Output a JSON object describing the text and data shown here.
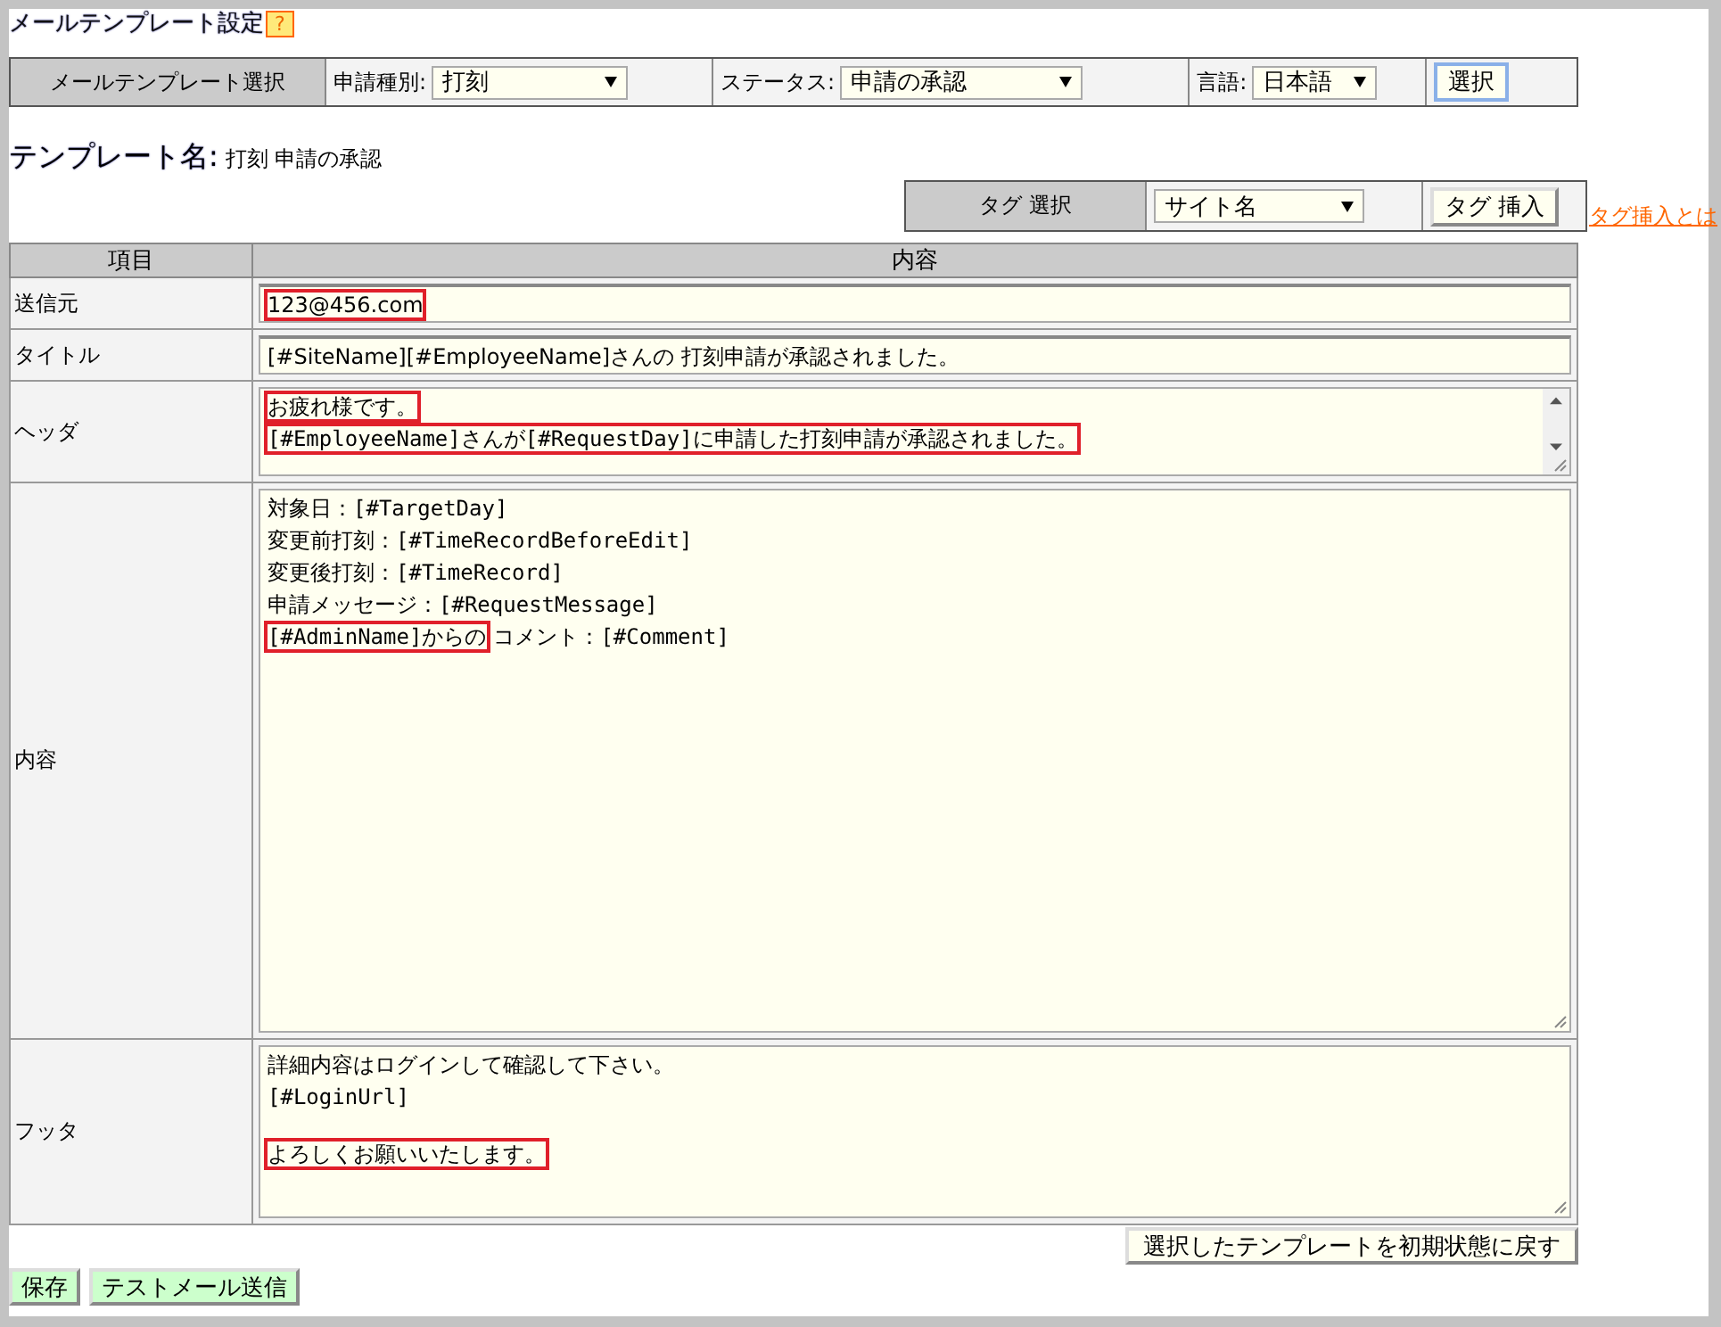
{
  "page_title": "メールテンプレート設定",
  "help_badge": "?",
  "selector_bar": {
    "label": "メールテンプレート選択",
    "fields": [
      {
        "label": "申請種別:",
        "value": "打刻"
      },
      {
        "label": "ステータス:",
        "value": "申請の承認"
      },
      {
        "label": "言語:",
        "value": "日本語"
      }
    ],
    "button": "選択"
  },
  "template_name": {
    "label": "テンプレート名:",
    "value": "打刻 申請の承認"
  },
  "tag_bar": {
    "label": "タグ 選択",
    "value": "サイト名",
    "button": "タグ 挿入",
    "help_link": "タグ挿入とは"
  },
  "table": {
    "columns": [
      "項目",
      "内容"
    ],
    "rows": [
      {
        "label": "送信元",
        "kind": "input",
        "paragraphs": [
          [
            [
              {
                "text": "123@456.com",
                "highlighted": true
              }
            ]
          ]
        ]
      },
      {
        "label": "タイトル",
        "kind": "input",
        "paragraphs": [
          [
            [
              {
                "text": "[#SiteName][#EmployeeName]さんの 打刻申請が承認されました。",
                "highlighted": false
              }
            ]
          ]
        ]
      },
      {
        "label": "ヘッダ",
        "kind": "textarea",
        "scrollable": true,
        "paragraphs": [
          [
            [
              {
                "text": "お疲れ様です。",
                "highlighted": true
              }
            ],
            [
              {
                "text": "[#EmployeeName]さんが[#RequestDay]に申請した打刻申請が承認されました。",
                "highlighted": true
              }
            ]
          ]
        ]
      },
      {
        "label": "内容",
        "kind": "textarea",
        "scrollable": false,
        "paragraphs": [
          [
            [
              {
                "text": "対象日：[#TargetDay]",
                "highlighted": false
              }
            ],
            [
              {
                "text": "変更前打刻：[#TimeRecordBeforeEdit]",
                "highlighted": false
              }
            ],
            [
              {
                "text": "変更後打刻：[#TimeRecord]",
                "highlighted": false
              }
            ],
            [
              {
                "text": "申請メッセージ：[#RequestMessage]",
                "highlighted": false
              }
            ],
            [
              {
                "text": "[#AdminName]からの",
                "highlighted": true
              },
              {
                "text": "コメント：[#Comment]",
                "highlighted": false
              }
            ]
          ]
        ]
      },
      {
        "label": "フッタ",
        "kind": "textarea",
        "scrollable": false,
        "paragraphs": [
          [
            [
              {
                "text": "詳細内容はログインして確認して下さい。",
                "highlighted": false
              }
            ],
            [
              {
                "text": "[#LoginUrl]",
                "highlighted": false
              }
            ]
          ],
          [
            [
              {
                "text": "よろしくお願いいたします。",
                "highlighted": true
              }
            ]
          ]
        ]
      }
    ]
  },
  "reset_button": "選択したテンプレートを初期状態に戻す",
  "buttons": [
    "保存",
    "テストメール送信"
  ]
}
